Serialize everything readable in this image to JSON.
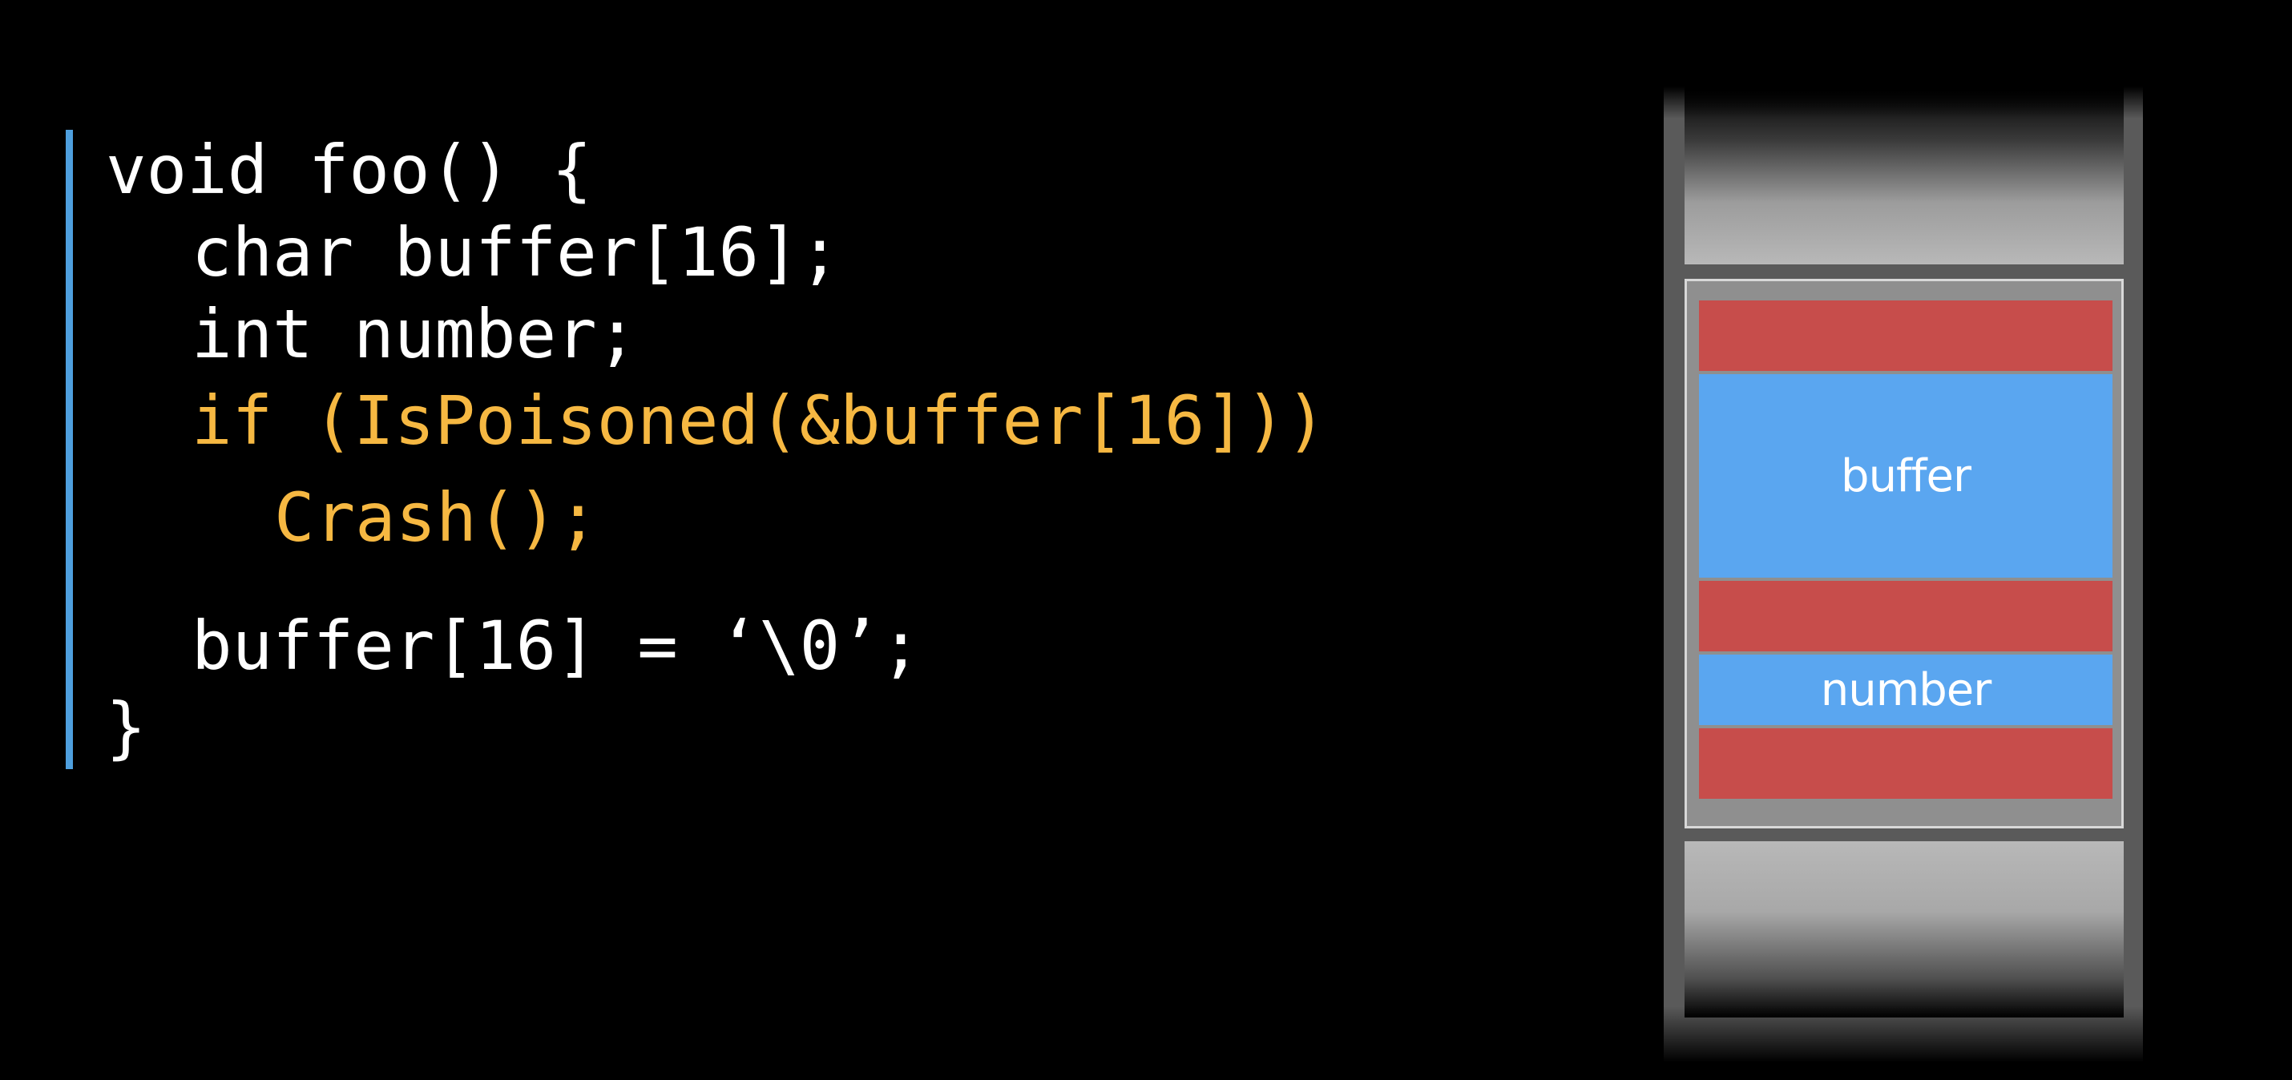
{
  "code": {
    "lines": [
      {
        "text": "void foo() {"
      },
      {
        "text": "char buffer[16];"
      },
      {
        "text": "int number;"
      },
      {
        "text": "if (IsPoisoned(&buffer[16]))"
      },
      {
        "text": "Crash();"
      },
      {
        "text": "buffer[16] = ‘\\0’;"
      },
      {
        "text": "}"
      }
    ],
    "colors": {
      "default": "#ffffff",
      "highlight": "#f6b842",
      "gutter": "#4e9fde"
    }
  },
  "stack_diagram": {
    "slots": [
      {
        "kind": "redzone",
        "label": ""
      },
      {
        "kind": "variable",
        "label": "buffer"
      },
      {
        "kind": "redzone",
        "label": ""
      },
      {
        "kind": "variable",
        "label": "number"
      },
      {
        "kind": "redzone",
        "label": ""
      }
    ],
    "colors": {
      "redzone": "#c74d4b",
      "variable": "#5aa6f0",
      "frame": "#8f8f8f",
      "column": "#5a5a5a"
    }
  }
}
